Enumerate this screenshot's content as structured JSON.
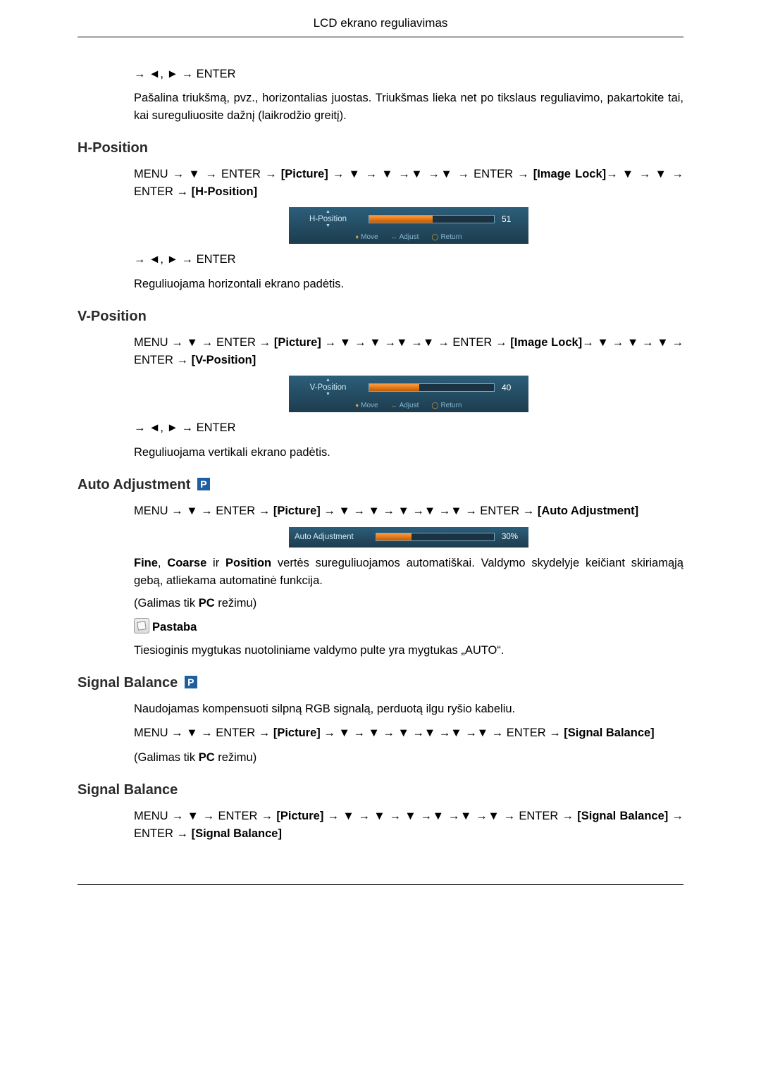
{
  "header_title": "LCD ekrano reguliavimas",
  "intro": {
    "nav": "→ ◄, ► → ENTER",
    "text": "Pašalina triukšmą, pvz., horizontalias juostas. Triukšmas lieka net po tikslaus reguliavimo, pakartokite tai, kai sureguliuosite dažnį (laikrodžio greitį)."
  },
  "hpos": {
    "heading": "H-Position",
    "nav1_pre": "MENU → ▼ → ENTER → ",
    "nav1_pic": "[Picture]",
    "nav1_mid": " → ▼ → ▼ →▼ →▼ → ENTER → ",
    "nav1_lock": "[Image Lock]",
    "nav1_post": "→ ▼ → ▼ → ENTER → ",
    "nav1_end": "[H-Position]",
    "osd": {
      "label": "H-Position",
      "value": "51",
      "fill_pct": 51,
      "hints": {
        "move": "Move",
        "adjust": "Adjust",
        "return": "Return"
      }
    },
    "nav2": "→ ◄, ► → ENTER",
    "desc": "Reguliuojama horizontali ekrano padėtis."
  },
  "vpos": {
    "heading": "V-Position",
    "nav1_pre": "MENU → ▼ → ENTER → ",
    "nav1_pic": "[Picture]",
    "nav1_mid": " → ▼ → ▼ →▼ →▼ → ENTER → ",
    "nav1_lock": "[Image Lock]",
    "nav1_post": "→ ▼ → ▼ → ▼ → ENTER → ",
    "nav1_end": "[V-Position]",
    "osd": {
      "label": "V-Position",
      "value": "40",
      "fill_pct": 40,
      "hints": {
        "move": "Move",
        "adjust": "Adjust",
        "return": "Return"
      }
    },
    "nav2": "→ ◄, ► → ENTER",
    "desc": "Reguliuojama vertikali ekrano padėtis."
  },
  "auto": {
    "heading": "Auto Adjustment ",
    "badge": "P",
    "nav1_pre": "MENU  →  ▼  →  ENTER  →  ",
    "nav1_pic": "[Picture]",
    "nav1_mid": "  →  ▼  →  ▼  →  ▼  →▼  →▼  →  ENTER  → ",
    "nav1_end": "[Auto Adjustment]",
    "osd": {
      "label": "Auto Adjustment",
      "value": "30%",
      "fill_pct": 30
    },
    "desc_b1": "Fine",
    "desc_m1": ", ",
    "desc_b2": "Coarse",
    "desc_m2": " ir ",
    "desc_b3": "Position",
    "desc_rest": " vertės sureguliuojamos automatiškai. Valdymo skydelyje keičiant skiriamąją gebą, atliekama automatinė funkcija.",
    "pc_only_pre": "(Galimas tik ",
    "pc_only_b": "PC",
    "pc_only_post": " režimu)",
    "note_label": "Pastaba",
    "note_text": "Tiesioginis mygtukas nuotoliniame valdymo pulte yra mygtukas „AUTO“."
  },
  "sigbal1": {
    "heading": "Signal Balance ",
    "badge": "P",
    "desc": "Naudojamas kompensuoti silpną RGB signalą, perduotą ilgu ryšio kabeliu.",
    "nav1_pre": "MENU  →  ▼  →  ENTER  →  ",
    "nav1_pic": "[Picture]",
    "nav1_mid": "  →  ▼  →  ▼  →  ▼  →▼  →▼  →▼  →  ENTER  → ",
    "nav1_end": "[Signal Balance]",
    "pc_only_pre": "(Galimas tik ",
    "pc_only_b": "PC",
    "pc_only_post": " režimu)"
  },
  "sigbal2": {
    "heading": "Signal Balance",
    "nav1_pre": "MENU → ▼ → ENTER → ",
    "nav1_pic": "[Picture]",
    "nav1_mid": " → ▼ → ▼ → ▼ →▼ →▼ →▼ → ENTER → ",
    "nav1_sb": "[Signal Balance]",
    "nav1_post": " → ENTER → ",
    "nav1_end": "[Signal Balance]"
  }
}
